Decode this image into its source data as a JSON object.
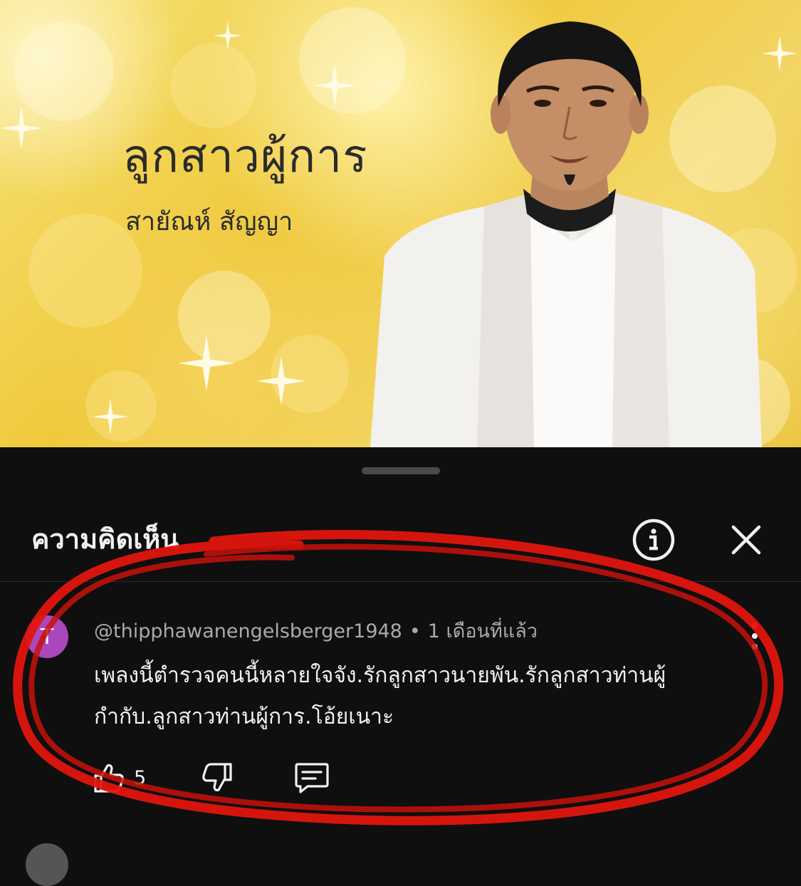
{
  "video": {
    "song_title": "ลูกสาวผู้การ",
    "artist": "สายัณห์ สัญญา"
  },
  "comments_panel": {
    "title": "ความคิดเห็น",
    "info_icon": "info-circle-icon",
    "close_icon": "close-icon",
    "comments": [
      {
        "avatar_letter": "T",
        "avatar_color": "#ab47bc",
        "author": "@thipphawanengelsberger1948",
        "separator": "•",
        "time": "1 เดือนที่แล้ว",
        "text": "เพลงนี้ตำรวจคนนี้หลายใจจัง.รักลูกสาวนายพัน.รักลูกสาวท่านผู้กำกับ.ลูกสาวท่านผู้การ.โอ้ยเนาะ",
        "likes": "5"
      }
    ]
  },
  "colors": {
    "sheet_bg": "#0f0f0f",
    "annotation": "#e0160e",
    "thumbnail_gold": "#efc93a"
  }
}
